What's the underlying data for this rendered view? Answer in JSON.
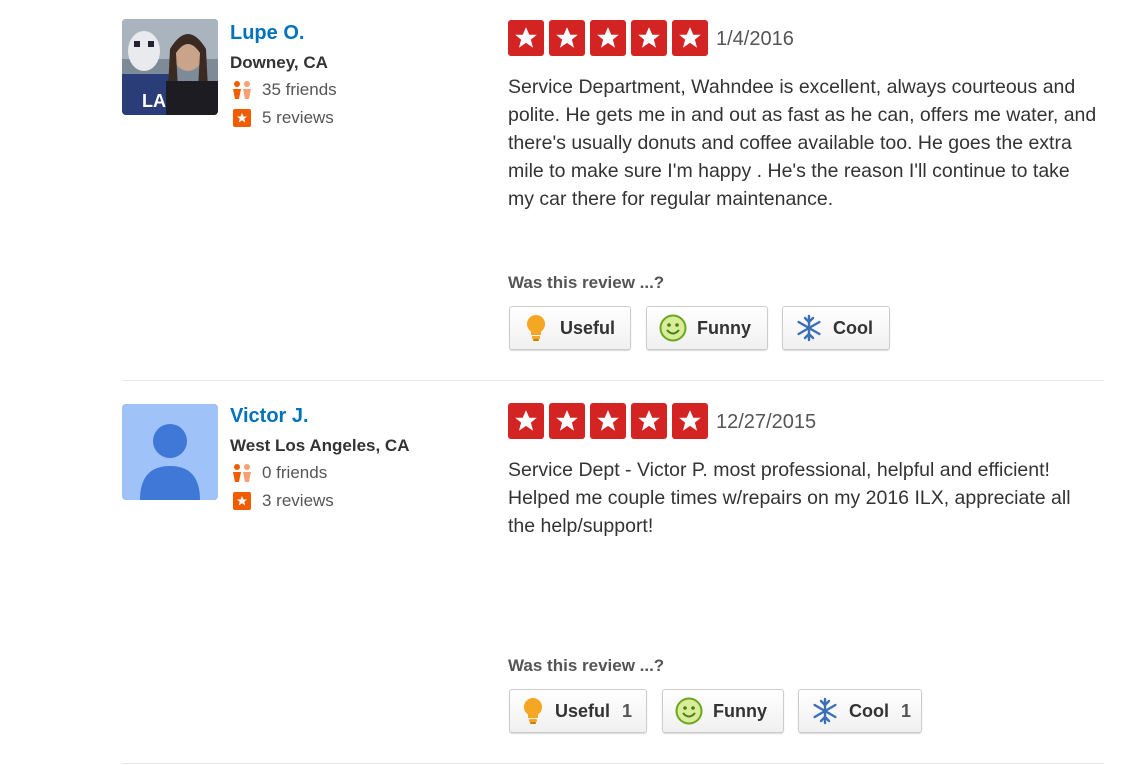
{
  "reviews": [
    {
      "user": {
        "name": "Lupe O.",
        "location": "Downey, CA",
        "friends": "35 friends",
        "reviews": "5 reviews",
        "avatar": "photo"
      },
      "rating": 5,
      "date": "1/4/2016",
      "text": "Service Department, Wahndee is excellent, always courteous and polite. He gets me in and out as fast as he can, offers me water, and there's usually donuts and coffee available too. He goes the extra mile to make sure I'm happy . He's the reason I'll continue to take my car there for regular maintenance.",
      "prompt": "Was this review ...?",
      "votes": {
        "useful": "Useful",
        "useful_count": "",
        "funny": "Funny",
        "funny_count": "",
        "cool": "Cool",
        "cool_count": ""
      }
    },
    {
      "user": {
        "name": "Victor J.",
        "location": "West Los Angeles, CA",
        "friends": "0 friends",
        "reviews": "3 reviews",
        "avatar": "default-user"
      },
      "rating": 5,
      "date": "12/27/2015",
      "text": "Service Dept - Victor P. most professional,  helpful and efficient!  Helped me couple times w/repairs on my 2016 ILX, appreciate all the help/support!",
      "prompt": "Was this review ...?",
      "votes": {
        "useful": "Useful",
        "useful_count": "1",
        "funny": "Funny",
        "funny_count": "",
        "cool": "Cool",
        "cool_count": "1"
      }
    }
  ],
  "colors": {
    "star": "#d32323",
    "link": "#0073bb",
    "review_icon": "#f15c00",
    "friends_icon": "#f15c00"
  },
  "icons": {
    "star": "star-icon",
    "friends": "friends-icon",
    "reviews": "review-count-icon",
    "useful": "lightbulb-icon",
    "funny": "smiley-icon",
    "cool": "snowflake-icon"
  }
}
